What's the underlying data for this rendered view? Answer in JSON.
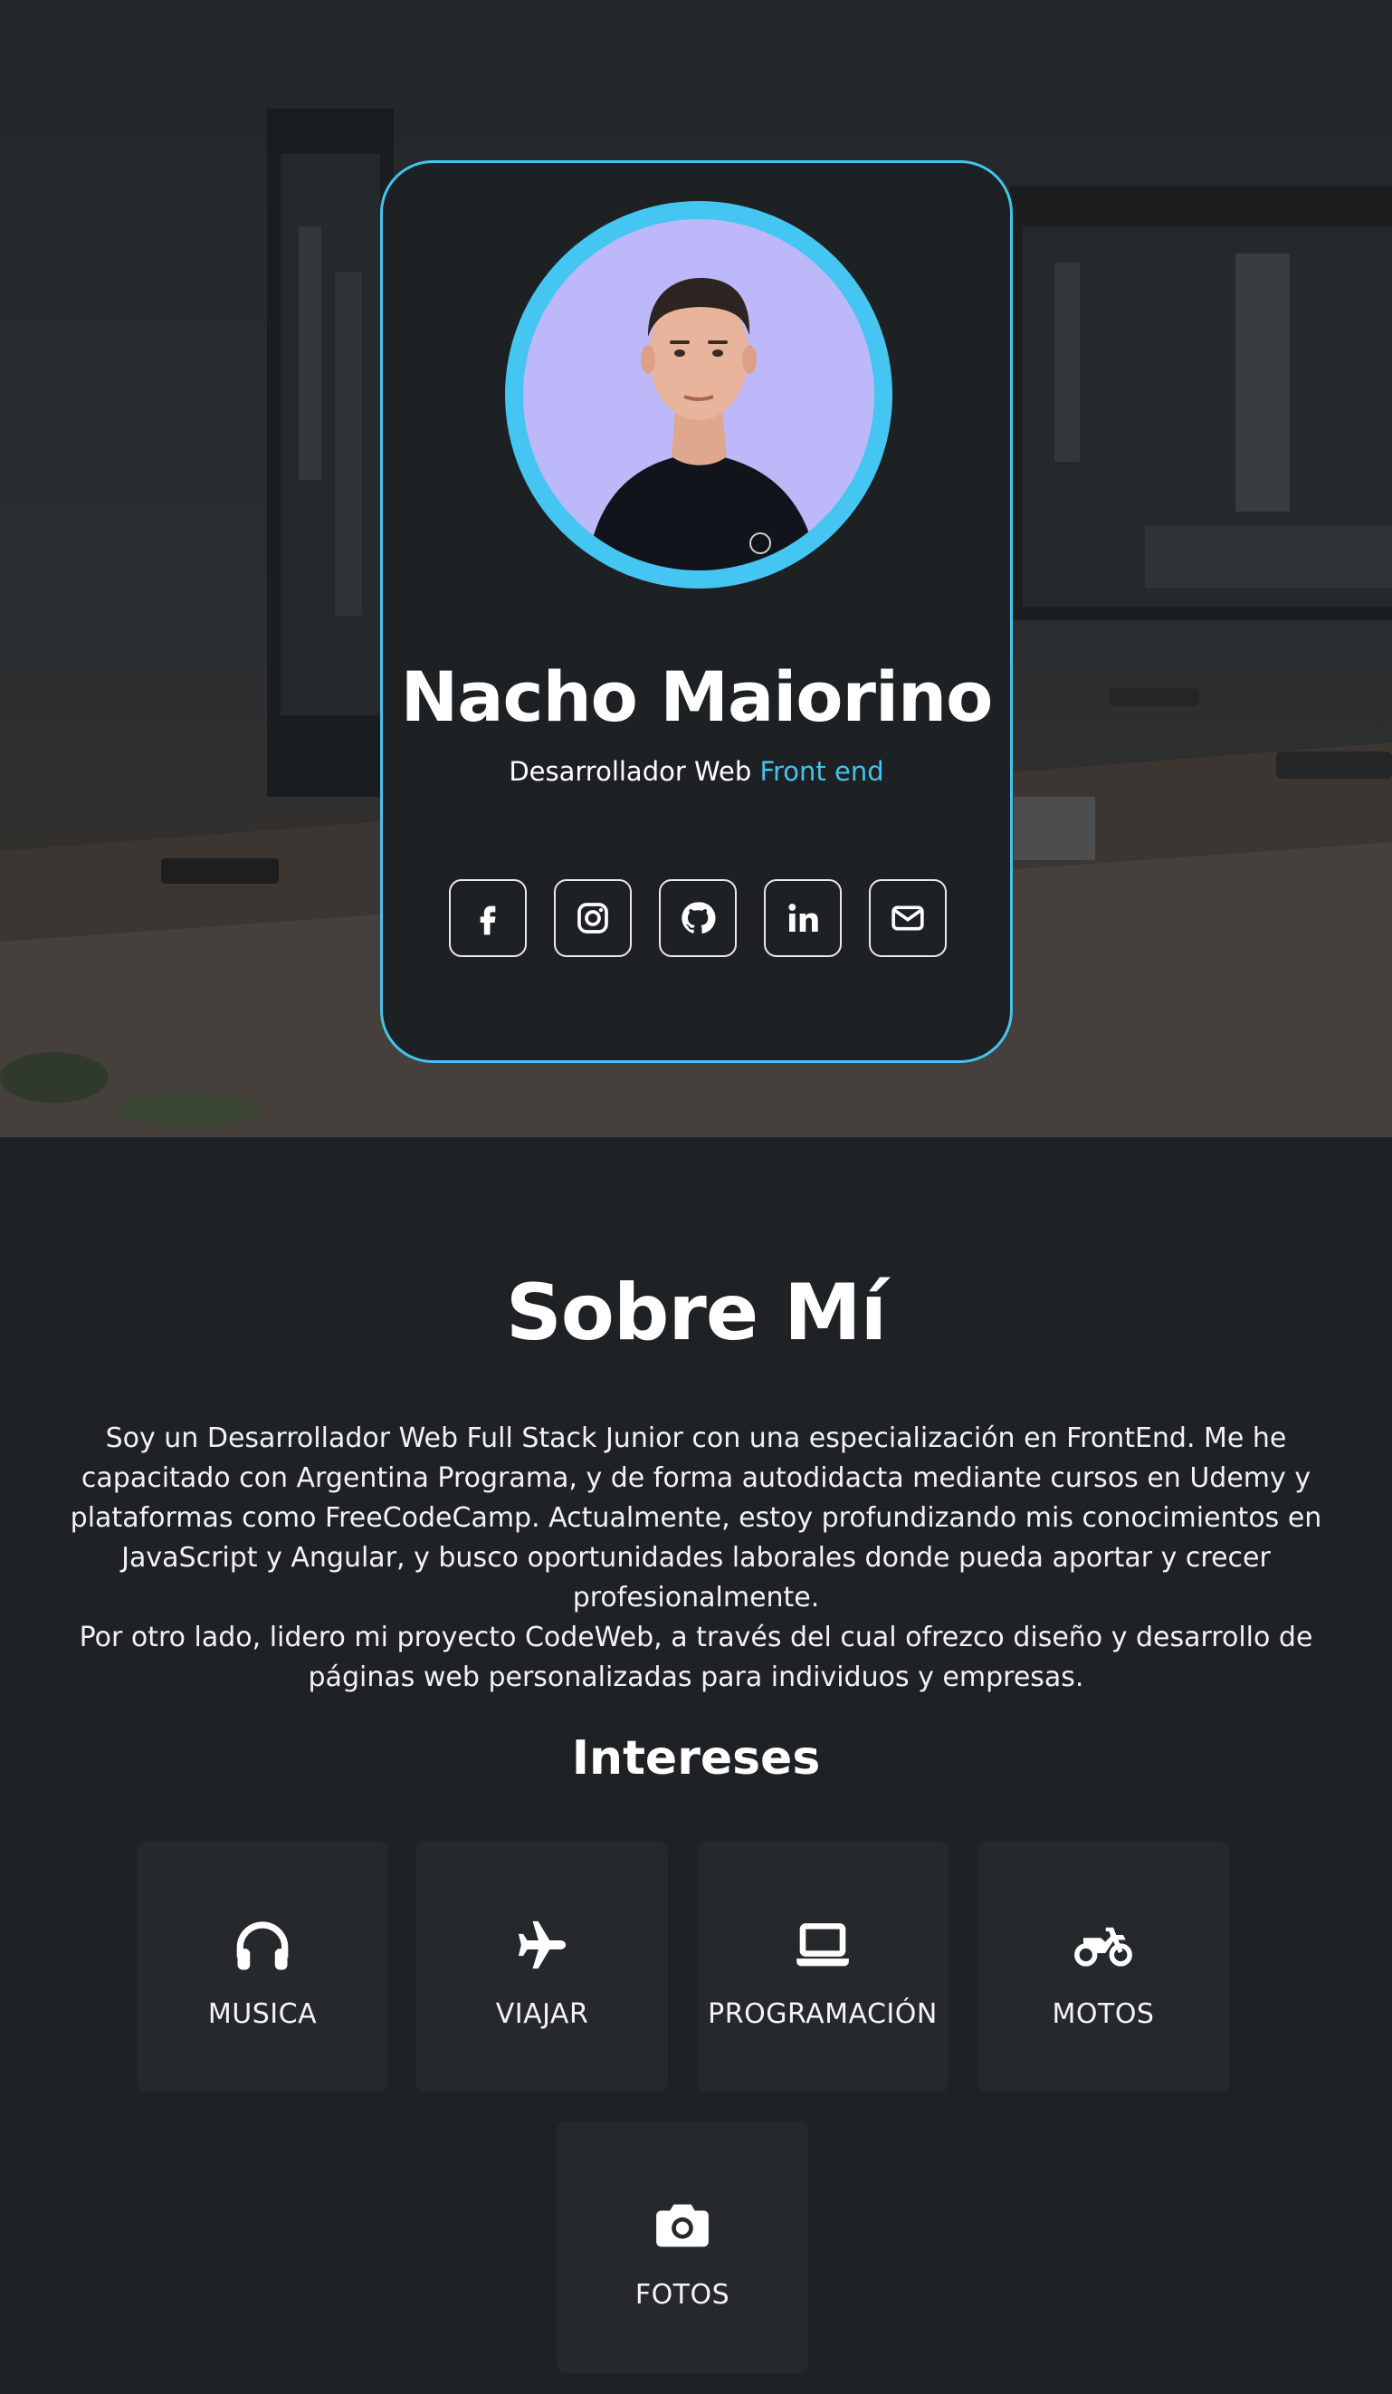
{
  "profile": {
    "name": "Nacho Maiorino",
    "role_prefix": "Desarrollador Web",
    "role_accent": "Front end"
  },
  "socials": [
    {
      "icon": "facebook-icon"
    },
    {
      "icon": "instagram-icon"
    },
    {
      "icon": "github-icon"
    },
    {
      "icon": "linkedin-icon"
    },
    {
      "icon": "envelope-icon"
    }
  ],
  "about": {
    "title": "Sobre Mí",
    "paragraph1": "Soy un Desarrollador Web Full Stack Junior con una especialización en FrontEnd. Me he capacitado con Argentina Programa, y de forma autodidacta mediante cursos en Udemy y plataformas como FreeCodeCamp. Actualmente, estoy profundizando mis conocimientos en JavaScript y Angular, y busco oportunidades laborales donde pueda aportar y crecer profesionalmente.",
    "paragraph2": "Por otro lado, lidero mi proyecto CodeWeb, a través del cual ofrezco diseño y desarrollo de páginas web personalizadas para individuos y empresas."
  },
  "interests": {
    "title": "Intereses",
    "items": [
      {
        "label": "MUSICA",
        "icon": "headphones-icon"
      },
      {
        "label": "VIAJAR",
        "icon": "plane-icon"
      },
      {
        "label": "PROGRAMACIÓN",
        "icon": "laptop-icon"
      },
      {
        "label": "MOTOS",
        "icon": "motorcycle-icon"
      },
      {
        "label": "FOTOS",
        "icon": "camera-icon"
      }
    ]
  },
  "colors": {
    "accent": "#43c3ee",
    "background": "#1f2225",
    "card": "#1e2124",
    "tile": "#25292c",
    "avatar_bg": "#bdb8f9"
  }
}
